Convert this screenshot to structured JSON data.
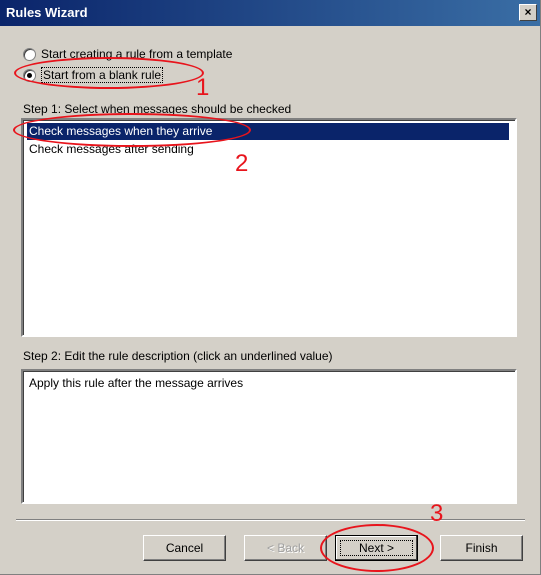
{
  "window": {
    "title": "Rules Wizard",
    "close_label": "×"
  },
  "options": {
    "template": "Start creating a rule from a template",
    "blank": "Start from a blank rule"
  },
  "step1": {
    "label": "Step 1: Select when messages should be checked",
    "items": [
      {
        "label": "Check messages when they arrive",
        "selected": true
      },
      {
        "label": "Check messages after sending",
        "selected": false
      }
    ]
  },
  "step2": {
    "label": "Step 2: Edit the rule description (click an underlined value)",
    "text": "Apply this rule after the message arrives"
  },
  "buttons": {
    "cancel": "Cancel",
    "back": "< Back",
    "next": "Next >",
    "finish": "Finish"
  },
  "annotations": {
    "n1": "1",
    "n2": "2",
    "n3": "3",
    "color": "#e8141c"
  },
  "colors": {
    "titlebar": "#0a246a",
    "selection": "#0a246a",
    "dialog": "#d4d0c8"
  }
}
